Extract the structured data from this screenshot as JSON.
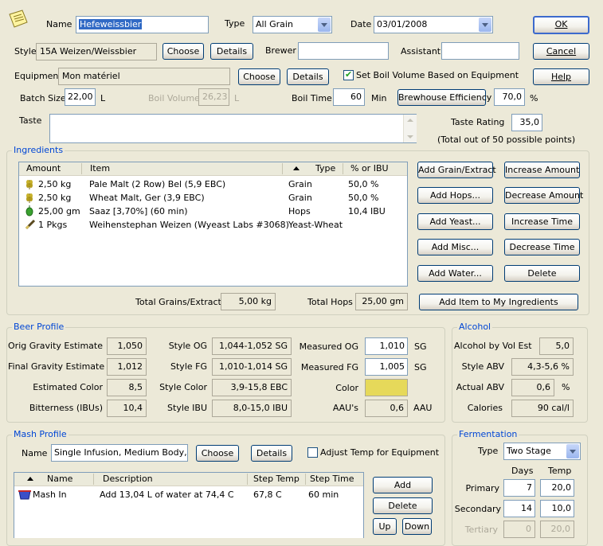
{
  "header": {
    "name_label": "Name",
    "name_value": "Hefeweissbier",
    "type_label": "Type",
    "type_value": "All Grain",
    "date_label": "Date",
    "date_value": "03/01/2008",
    "style_label": "Style",
    "style_value": "15A Weizen/Weissbier",
    "choose_label": "Choose",
    "details_label": "Details",
    "brewer_label": "Brewer",
    "brewer_value": "",
    "assistant_label": "Assistant",
    "assistant_value": "",
    "equipment_label": "Equipment",
    "equipment_value": "Mon matériel",
    "set_boil_label": "Set Boil Volume Based on Equipment",
    "batch_label": "Batch Size",
    "batch_value": "22,00",
    "batch_unit": "L",
    "boil_volume_label": "Boil Volume",
    "boil_volume_value": "26,23",
    "boil_volume_unit": "L",
    "boil_time_label": "Boil Time",
    "boil_time_value": "60",
    "boil_time_unit": "Min",
    "efficiency_label": "Brewhouse Efficiency",
    "efficiency_value": "70,0",
    "efficiency_unit": "%",
    "taste_label": "Taste",
    "taste_value": "",
    "rating_label": "Taste Rating",
    "rating_value": "35,0",
    "rating_note": "(Total out of 50 possible points)"
  },
  "dialog_buttons": {
    "ok": "OK",
    "cancel": "Cancel",
    "help": "Help"
  },
  "ingredients": {
    "title": "Ingredients",
    "columns": [
      "Amount",
      "Item",
      "Type",
      "% or IBU"
    ],
    "rows": [
      {
        "icon": "grain-icon",
        "amount": "2,50 kg",
        "item": "Pale Malt (2 Row) Bel (5,9 EBC)",
        "type": "Grain",
        "pct": "50,0 %"
      },
      {
        "icon": "grain-icon",
        "amount": "2,50 kg",
        "item": "Wheat Malt, Ger (3,9 EBC)",
        "type": "Grain",
        "pct": "50,0 %"
      },
      {
        "icon": "hop-icon",
        "amount": "25,00 gm",
        "item": "Saaz [3,70%]  (60 min)",
        "type": "Hops",
        "pct": "10,4 IBU"
      },
      {
        "icon": "yeast-icon",
        "amount": "1 Pkgs",
        "item": "Weihenstephan Weizen (Wyeast Labs #3068)",
        "type": "Yeast-Wheat",
        "pct": ""
      }
    ],
    "buttons": {
      "add_grain": "Add Grain/Extract",
      "add_hops": "Add Hops...",
      "add_yeast": "Add Yeast...",
      "add_misc": "Add Misc...",
      "add_water": "Add Water...",
      "inc_amount": "Increase Amount",
      "dec_amount": "Decrease Amount",
      "inc_time": "Increase Time",
      "dec_time": "Decrease Time",
      "delete": "Delete",
      "add_to_my": "Add Item to My Ingredients"
    },
    "total_grains_label": "Total Grains/Extracts",
    "total_grains_value": "5,00 kg",
    "total_hops_label": "Total Hops",
    "total_hops_value": "25,00 gm"
  },
  "beer_profile": {
    "title": "Beer Profile",
    "og_est_label": "Orig Gravity Estimate",
    "og_est": "1,050",
    "fg_est_label": "Final Gravity Estimate",
    "fg_est": "1,012",
    "color_est_label": "Estimated Color",
    "color_est": "8,5",
    "ibu_label": "Bitterness (IBUs)",
    "ibu": "10,4",
    "style_og_label": "Style OG",
    "style_og": "1,044-1,052 SG",
    "style_fg_label": "Style FG",
    "style_fg": "1,010-1,014 SG",
    "style_color_label": "Style Color",
    "style_color": "3,9-15,8 EBC",
    "style_ibu_label": "Style IBU",
    "style_ibu": "8,0-15,0 IBU",
    "measured_og_label": "Measured OG",
    "measured_og": "1,010",
    "og_unit": "SG",
    "measured_fg_label": "Measured FG",
    "measured_fg": "1,005",
    "fg_unit": "SG",
    "color_label": "Color",
    "color_swatch": "#e6d95a",
    "aau_label": "AAU's",
    "aau": "0,6",
    "aau_unit": "AAU"
  },
  "alcohol": {
    "title": "Alcohol",
    "abv_est_label": "Alcohol by Vol Est",
    "abv_est": "5,0",
    "style_abv_label": "Style ABV",
    "style_abv": "4,3-5,6 %",
    "actual_abv_label": "Actual ABV",
    "actual_abv": "0,6",
    "actual_unit": "%",
    "calories_label": "Calories",
    "calories": "90 cal/l"
  },
  "mash": {
    "title": "Mash Profile",
    "name_label": "Name",
    "name_value": "Single Infusion, Medium Body, No",
    "choose_label": "Choose",
    "details_label": "Details",
    "adjust_label": "Adjust Temp for Equipment",
    "columns": [
      "Name",
      "Description",
      "Step Temp",
      "Step Time"
    ],
    "rows": [
      {
        "name": "Mash In",
        "description": "Add 13,04 L of water at 74,4 C",
        "temp": "67,8 C",
        "time": "60 min"
      }
    ],
    "add_label": "Add",
    "delete_label": "Delete",
    "up_label": "Up",
    "down_label": "Down"
  },
  "fermentation": {
    "title": "Fermentation",
    "type_label": "Type",
    "type_value": "Two Stage",
    "days_label": "Days",
    "temp_label": "Temp",
    "primary_label": "Primary",
    "primary_days": "7",
    "primary_temp": "20,0",
    "secondary_label": "Secondary",
    "secondary_days": "14",
    "secondary_temp": "10,0",
    "tertiary_label": "Tertiary",
    "tertiary_days": "0",
    "tertiary_temp": "20,0"
  }
}
